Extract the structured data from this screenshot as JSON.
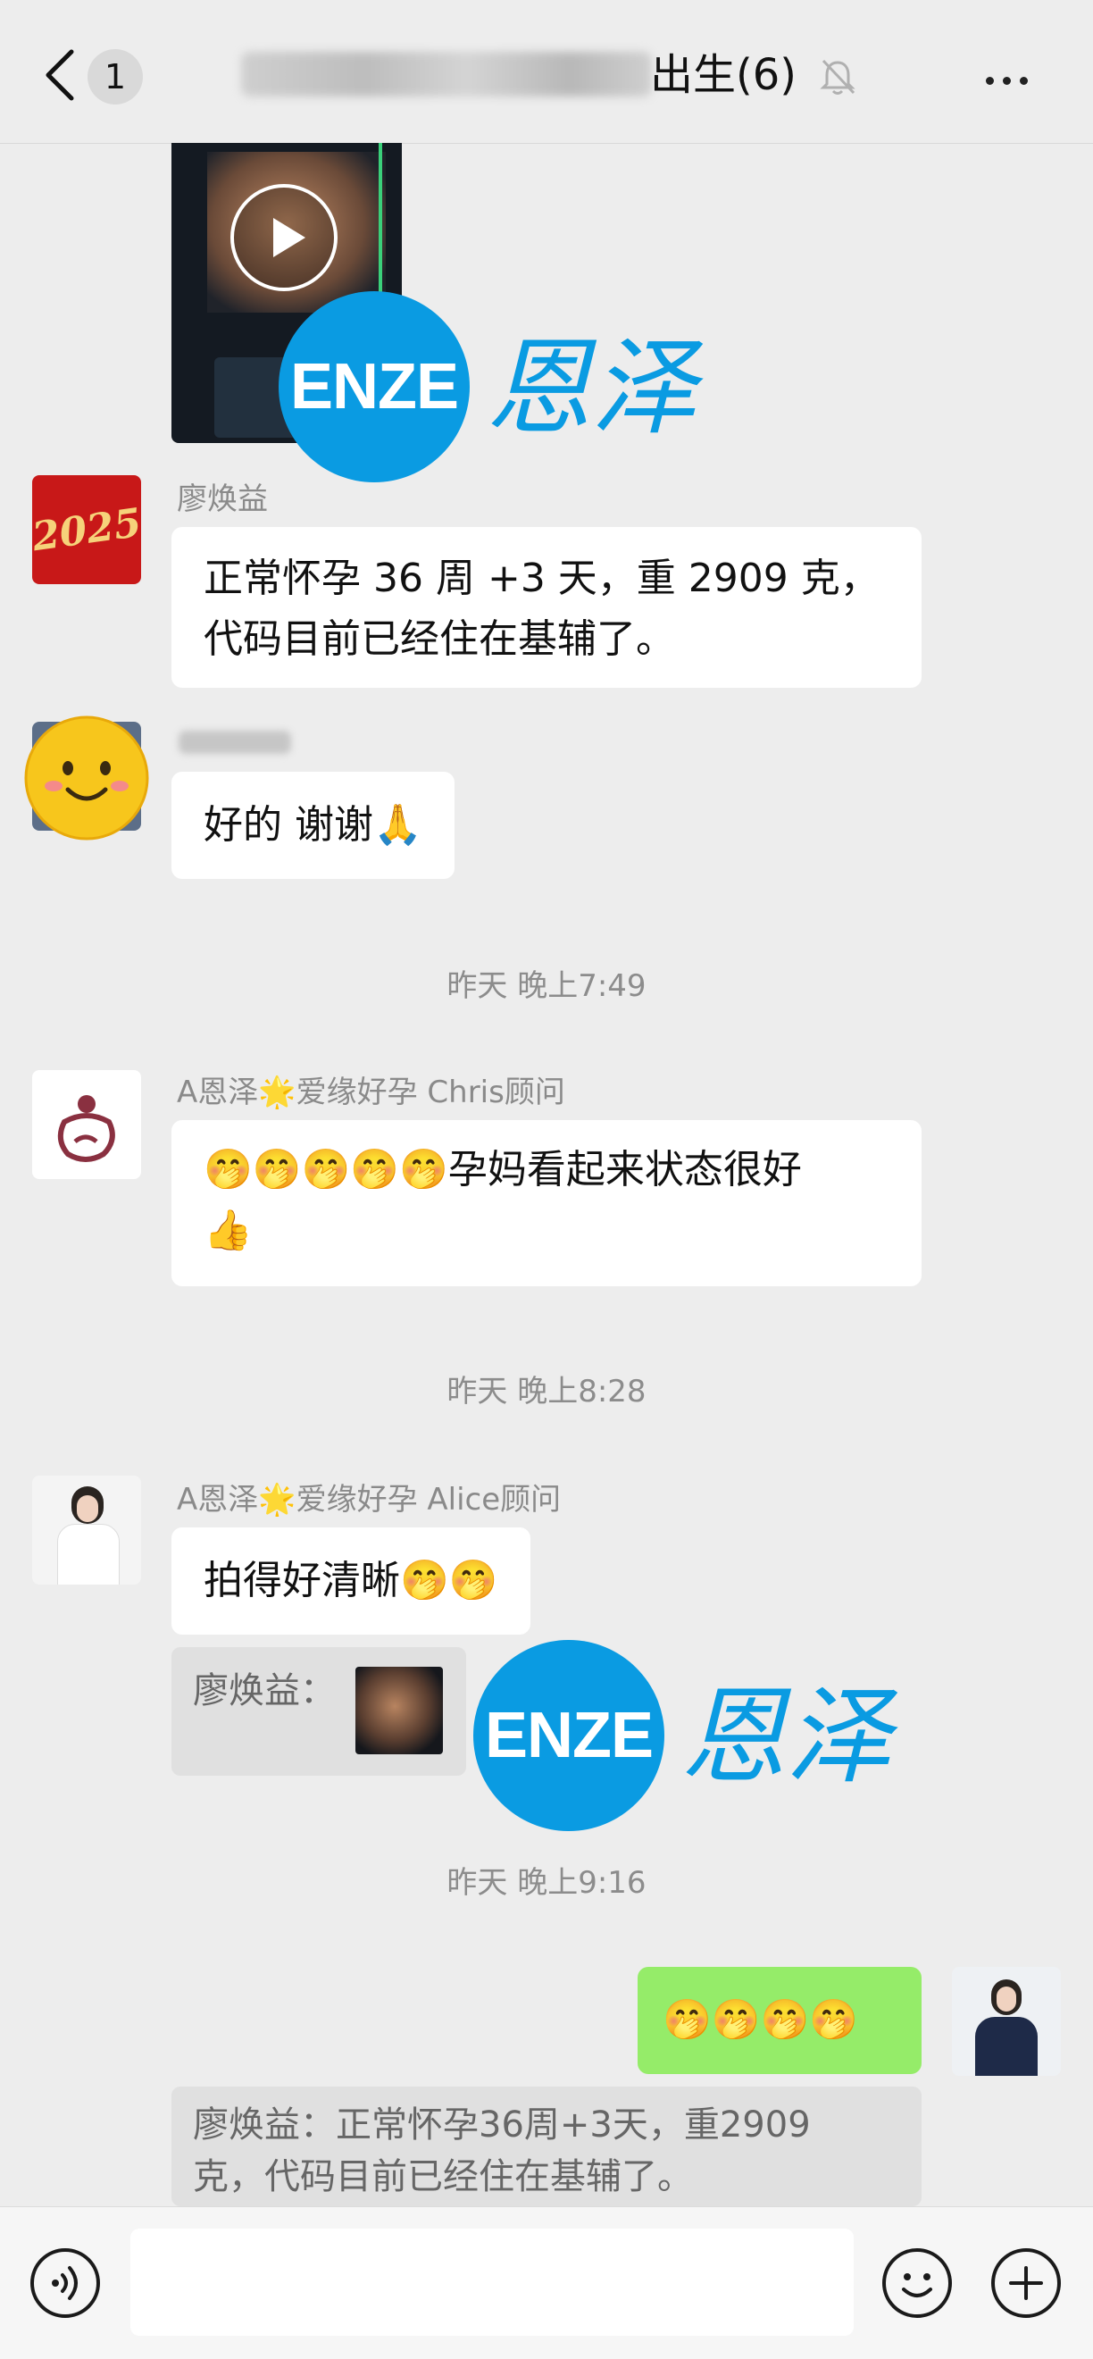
{
  "header": {
    "back_badge": "1",
    "title_visible": "出生(6)"
  },
  "watermark": {
    "logo_text": "ENZE",
    "logo_cn": "恩泽"
  },
  "messages": [
    {
      "sender": "廖焕益",
      "avatar_text": "2025",
      "text_line1": "正常怀孕 36 周 +3 天，重 2909 克，",
      "text_line2": "代码目前已经住在基辅了。"
    },
    {
      "text": "好的 谢谢🙏"
    },
    {
      "sender": "A恩泽🌟爱缘好孕 Chris顾问",
      "text_line1": "🤭🤭🤭🤭🤭孕妈看起来状态很好",
      "text_line2": "👍"
    },
    {
      "sender": "A恩泽🌟爱缘好孕 Alice顾问",
      "text": "拍得好清晰🤭🤭",
      "quote_label": "廖焕益："
    },
    {
      "text": "🤭🤭🤭🤭",
      "quote_line1": "廖焕益：正常怀孕36周+3天，重2909",
      "quote_line2": "克，代码目前已经住在基辅了。"
    }
  ],
  "times": [
    "昨天 晚上7:49",
    "昨天 晚上8:28",
    "昨天 晚上9:16"
  ],
  "colors": {
    "accent_blue": "#0a9be2",
    "my_bubble": "#95ec69",
    "background": "#ededed"
  }
}
